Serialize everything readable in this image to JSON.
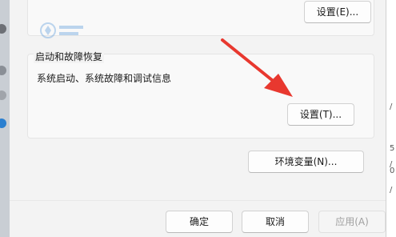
{
  "performance_group": {
    "settings_button": "设置(E)..."
  },
  "startup_group": {
    "title": "启动和故障恢复",
    "description": "系统启动、系统故障和调试信息",
    "settings_button": "设置(T)..."
  },
  "environment_variables_button": "环境变量(N)...",
  "footer": {
    "ok": "确定",
    "cancel": "取消",
    "apply": "应用(A)"
  },
  "background_right_text": [
    "/",
    "5",
    "/",
    "0",
    "/"
  ],
  "colors": {
    "arrow": "#e8382f",
    "dialog_bg": "#f3f3f3",
    "group_bg": "#f9f9f9",
    "disabled_text": "#a0a0a0"
  },
  "icons": [
    "red-arrow-annotation",
    "watermark-logo"
  ]
}
